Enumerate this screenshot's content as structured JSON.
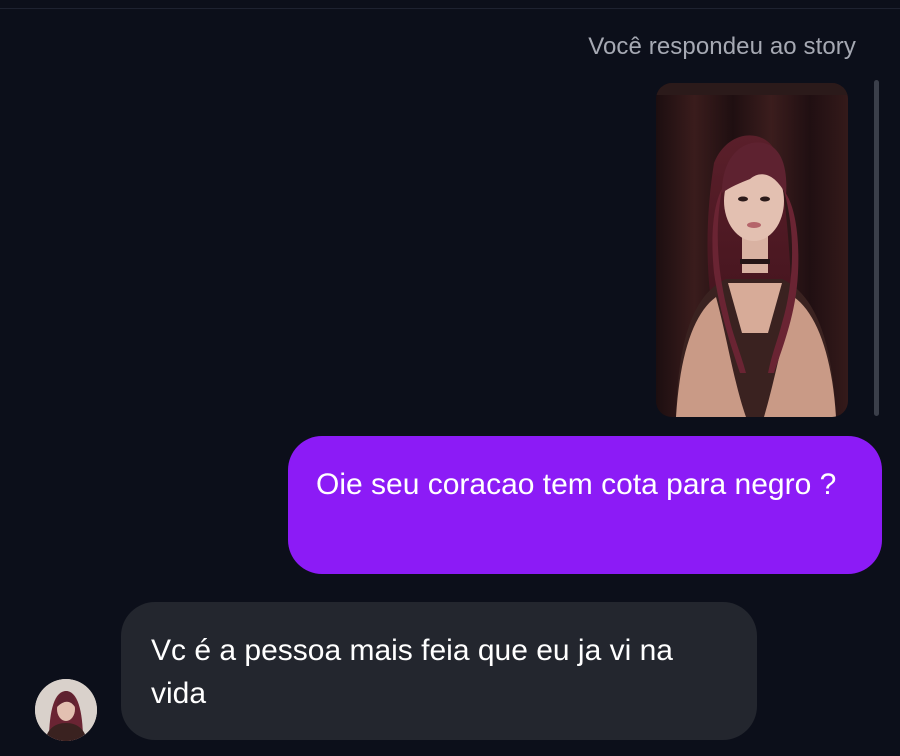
{
  "chat": {
    "reply_caption": "Você respondeu ao story",
    "story_thumbnail": {
      "icon": "story-photo"
    },
    "messages": [
      {
        "direction": "sent",
        "text": "Oie seu coracao tem cota para negro ?"
      },
      {
        "direction": "received",
        "text": "Vc é a pessoa mais feia que eu ja vi na vida"
      }
    ],
    "sender_avatar": {
      "icon": "contact-avatar"
    }
  },
  "colors": {
    "background": "#0c0f1a",
    "sent_bubble": "#8c1bf6",
    "received_bubble": "#23262e",
    "caption_text": "#a6a9b3"
  }
}
